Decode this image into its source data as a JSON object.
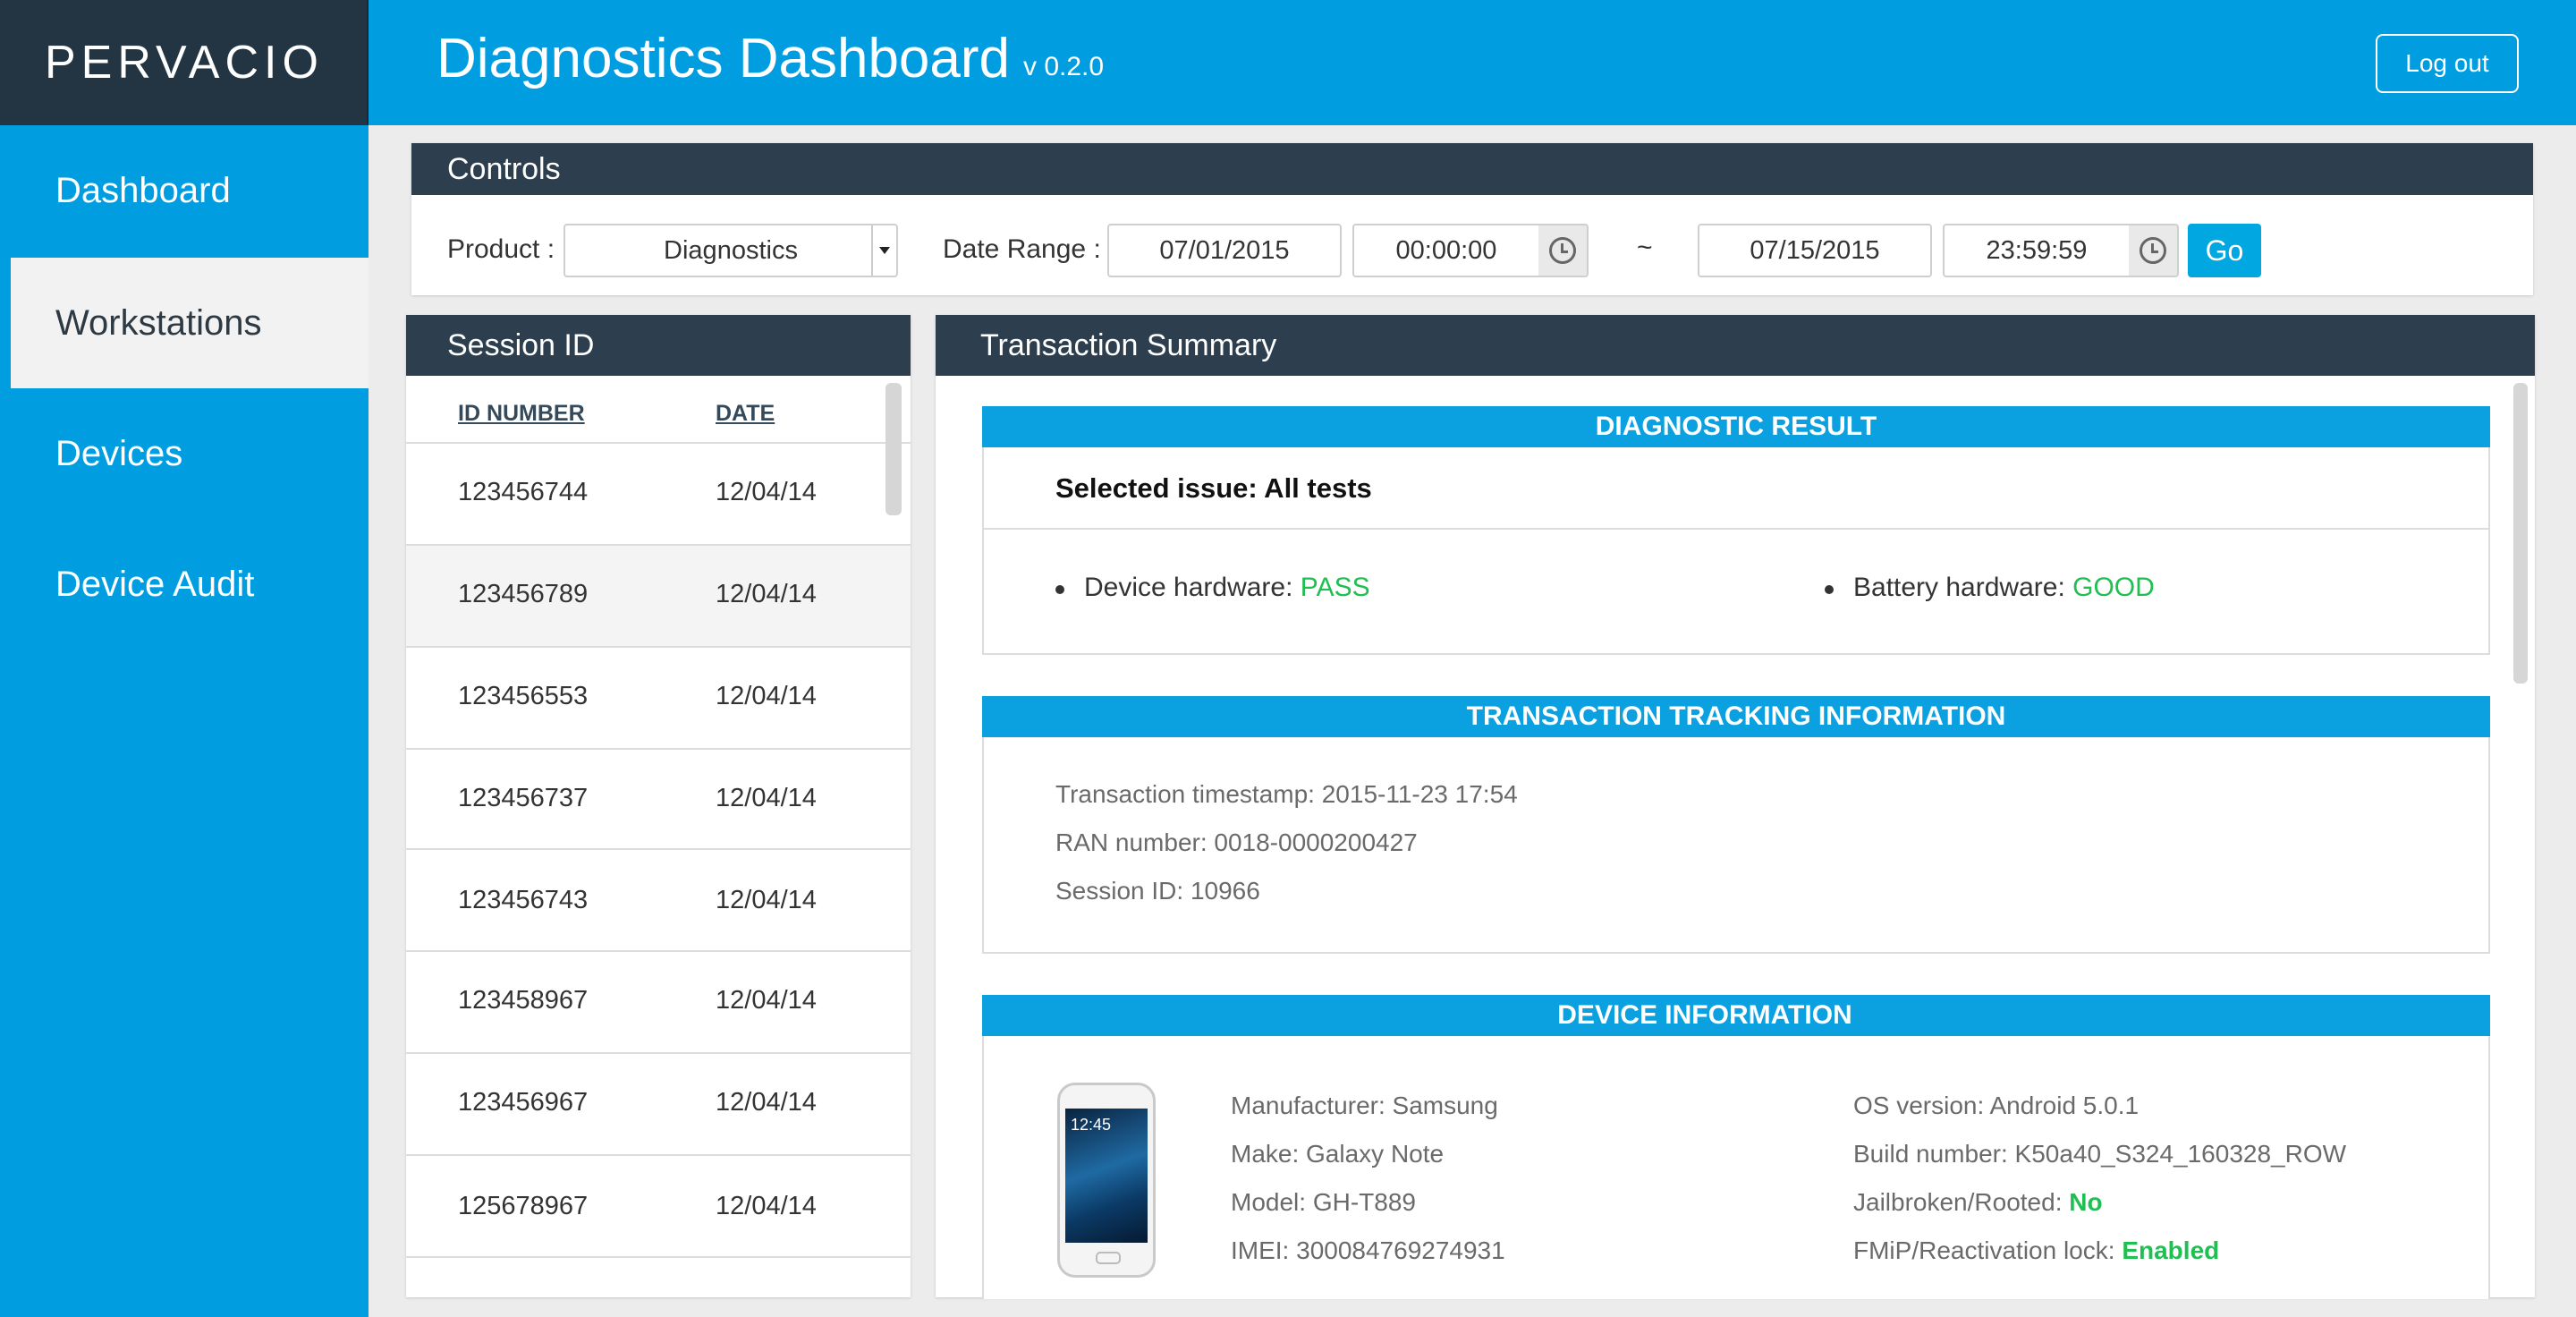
{
  "header": {
    "logo": "PERVACIO",
    "title": "Diagnostics Dashboard",
    "version": "v 0.2.0",
    "logout_label": "Log out"
  },
  "sidebar": {
    "items": [
      {
        "label": "Dashboard"
      },
      {
        "label": "Workstations"
      },
      {
        "label": "Devices"
      },
      {
        "label": "Device Audit"
      }
    ]
  },
  "controls": {
    "title": "Controls",
    "product_label": "Product :",
    "product_value": "Diagnostics",
    "date_range_label": "Date Range :",
    "start_date": "07/01/2015",
    "start_time": "00:00:00",
    "separator": "~",
    "end_date": "07/15/2015",
    "end_time": "23:59:59",
    "go_label": "Go"
  },
  "session": {
    "title": "Session ID",
    "col_id": "ID NUMBER",
    "col_date": "DATE",
    "rows": [
      {
        "id": "123456744",
        "date": "12/04/14"
      },
      {
        "id": "123456789",
        "date": "12/04/14"
      },
      {
        "id": "123456553",
        "date": "12/04/14"
      },
      {
        "id": "123456737",
        "date": "12/04/14"
      },
      {
        "id": "123456743",
        "date": "12/04/14"
      },
      {
        "id": "123458967",
        "date": "12/04/14"
      },
      {
        "id": "123456967",
        "date": "12/04/14"
      },
      {
        "id": "125678967",
        "date": "12/04/14"
      }
    ]
  },
  "summary": {
    "title": "Transaction Summary",
    "diagnostic": {
      "heading": "DIAGNOSTIC RESULT",
      "selected_issue": "Selected issue: All tests",
      "device_hw_label": "Device hardware:",
      "device_hw_value": "PASS",
      "battery_hw_label": "Battery hardware:",
      "battery_hw_value": "GOOD"
    },
    "tracking": {
      "heading": "TRANSACTION TRACKING INFORMATION",
      "timestamp": "Transaction timestamp: 2015-11-23 17:54",
      "ran": "RAN number: 0018-0000200427",
      "session": "Session ID: 10966"
    },
    "device": {
      "heading": "DEVICE INFORMATION",
      "phone_time": "12:45",
      "manufacturer": "Manufacturer: Samsung",
      "make": "Make: Galaxy Note",
      "model": "Model: GH-T889",
      "imei": "IMEI: 300084769274931",
      "os": "OS version: Android 5.0.1",
      "build": "Build number: K50a40_S324_160328_ROW",
      "jailbroken_label": "Jailbroken/Rooted:",
      "jailbroken_value": "No",
      "fmip_label": "FMiP/Reactivation lock:",
      "fmip_value": "Enabled"
    }
  },
  "colors": {
    "brand_blue": "#009ee0",
    "dark_header": "#2d3e4e",
    "logo_bg": "#233442",
    "status_green": "#1fbf52"
  }
}
